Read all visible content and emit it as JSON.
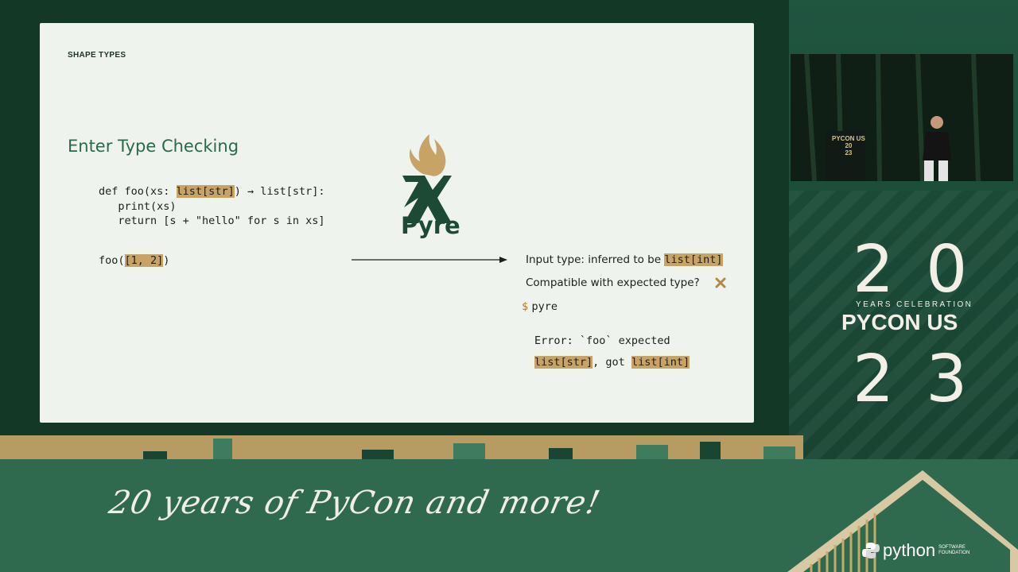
{
  "slide": {
    "section_label": "SHAPE TYPES",
    "title": "Enter Type Checking",
    "code": {
      "l1_pre": "def foo(xs: ",
      "l1_hl": "list[str]",
      "l1_post": ") → list[str]:",
      "l2": "   print(xs)",
      "l3": "   return [s + \"hello\" for s in xs]",
      "call_pre": "foo(",
      "call_hl": "[1, 2]",
      "call_post": ")"
    },
    "logo_word": "Pyre",
    "info": {
      "input_type_text": "Input type: inferred to be ",
      "input_type_value": "list[int]",
      "compatible_text": "Compatible with expected type?",
      "prompt_symbol": "$",
      "prompt_command": "pyre",
      "error_line1": "Error: `foo` expected",
      "error_expected": "list[str]",
      "error_mid": ", got ",
      "error_got": "list[int]"
    }
  },
  "camera": {
    "podium_text_1": "PYCON US",
    "podium_text_2": "20",
    "podium_text_3": "23"
  },
  "branding": {
    "num_top": "20",
    "years_celebration": "YEARS CELEBRATION",
    "pycon_us": "PYCON US",
    "num_bottom": "23"
  },
  "banner": {
    "tagline": "20 years of PyCon and more!",
    "psf_word": "python",
    "psf_small": "SOFTWARE FOUNDATION"
  },
  "colors": {
    "accent_green": "#2a6a48",
    "highlight_gold": "#c8a366",
    "background_green": "#1d4a35"
  }
}
